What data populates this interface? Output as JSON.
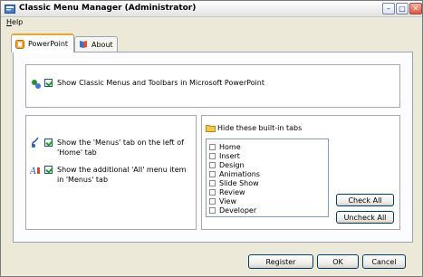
{
  "window": {
    "title": "Classic Menu Manager (Administrator)",
    "title_buttons": {
      "minimize": "–",
      "maximize": "□",
      "close": "✕"
    }
  },
  "menubar": {
    "help": "Help"
  },
  "tabs": [
    {
      "label": "PowerPoint",
      "active": true,
      "icon": "powerpoint-tab-icon"
    },
    {
      "label": "About",
      "active": false,
      "icon": "about-tab-icon"
    }
  ],
  "options": {
    "show_classic_menus": {
      "label": "Show Classic Menus and Toolbars in Microsoft PowerPoint",
      "checked": true,
      "icon": "classic-menus-icon"
    },
    "show_menus_tab": {
      "label": "Show the 'Menus' tab on the left of 'Home' tab",
      "checked": true,
      "icon": "menus-tab-icon"
    },
    "show_all_item": {
      "label": "Show the additional 'All' menu item in 'Menus' tab",
      "checked": true,
      "icon": "all-menu-item-icon"
    }
  },
  "hide_tabs": {
    "heading": "Hide these built-in tabs",
    "icon": "folder-icon",
    "items": [
      {
        "label": "Home",
        "checked": false
      },
      {
        "label": "Insert",
        "checked": false
      },
      {
        "label": "Design",
        "checked": false
      },
      {
        "label": "Animations",
        "checked": false
      },
      {
        "label": "Slide Show",
        "checked": false
      },
      {
        "label": "Review",
        "checked": false
      },
      {
        "label": "View",
        "checked": false
      },
      {
        "label": "Developer",
        "checked": false
      }
    ],
    "check_all_label": "Check All",
    "uncheck_all_label": "Uncheck All"
  },
  "footer": {
    "register_label": "Register",
    "ok_label": "OK",
    "cancel_label": "Cancel"
  }
}
